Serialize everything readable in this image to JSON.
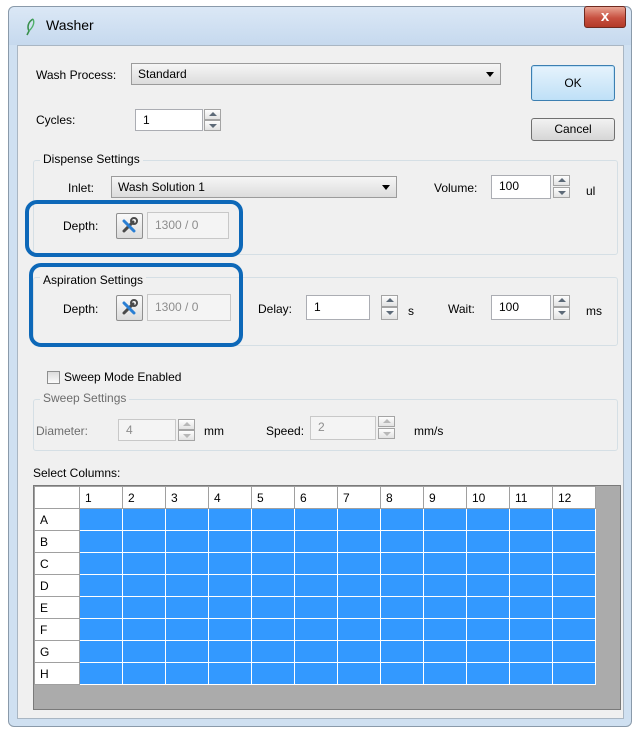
{
  "window": {
    "title": "Washer",
    "close_label": "x"
  },
  "wash_process": {
    "label": "Wash Process:",
    "value": "Standard"
  },
  "cycles": {
    "label": "Cycles:",
    "value": "1"
  },
  "buttons": {
    "ok": "OK",
    "cancel": "Cancel"
  },
  "dispense": {
    "title": "Dispense Settings",
    "inlet_label": "Inlet:",
    "inlet_value": "Wash Solution 1",
    "volume_label": "Volume:",
    "volume_value": "100",
    "volume_unit": "ul",
    "depth_label": "Depth:",
    "depth_value": "1300 / 0"
  },
  "aspiration": {
    "title": "Aspiration Settings",
    "depth_label": "Depth:",
    "depth_value": "1300 / 0",
    "delay_label": "Delay:",
    "delay_value": "1",
    "delay_unit": "s",
    "wait_label": "Wait:",
    "wait_value": "100",
    "wait_unit": "ms"
  },
  "sweep": {
    "mode_label": "Sweep Mode Enabled",
    "mode_checked": false,
    "title": "Sweep Settings",
    "diameter_label": "Diameter:",
    "diameter_value": "4",
    "diameter_unit": "mm",
    "speed_label": "Speed:",
    "speed_value": "2",
    "speed_unit": "mm/s"
  },
  "columns": {
    "label": "Select Columns:",
    "headers": [
      "1",
      "2",
      "3",
      "4",
      "5",
      "6",
      "7",
      "8",
      "9",
      "10",
      "11",
      "12"
    ],
    "rows": [
      "A",
      "B",
      "C",
      "D",
      "E",
      "F",
      "G",
      "H"
    ],
    "selected_color": "#3399ff"
  },
  "icons": {
    "app": "feather-icon",
    "depth_tool": "tools-icon"
  },
  "colors": {
    "highlight": "#0d68b8"
  }
}
